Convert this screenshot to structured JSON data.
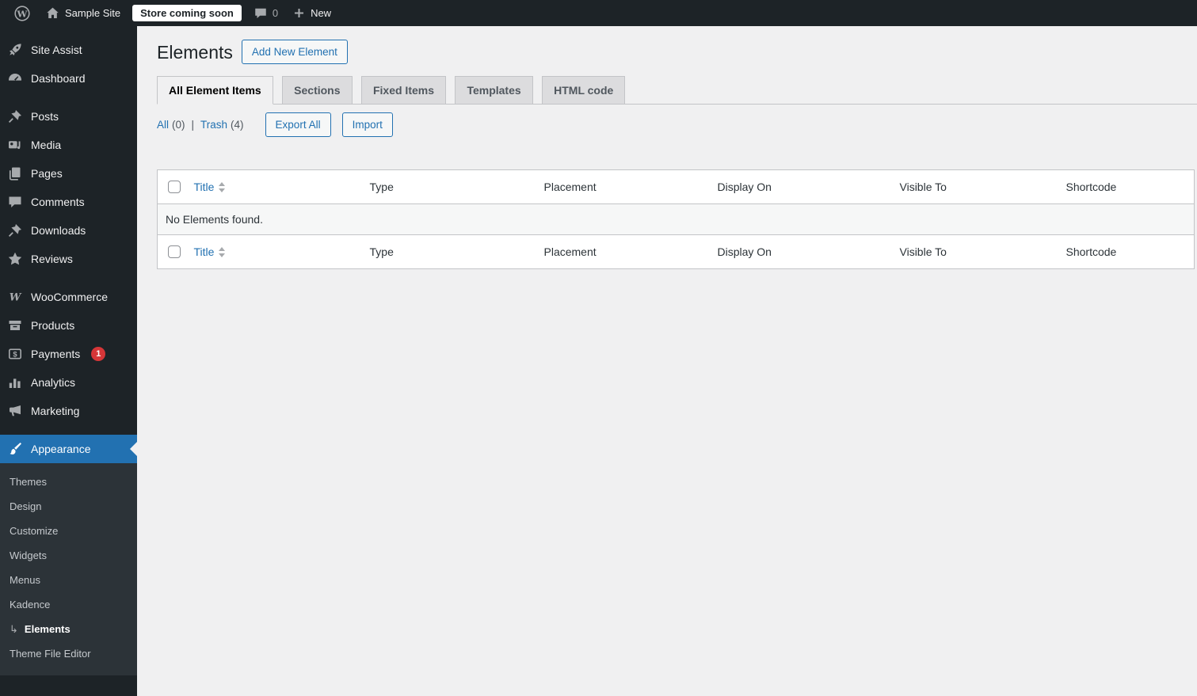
{
  "admin_bar": {
    "site_name": "Sample Site",
    "store_badge": "Store coming soon",
    "comment_count": "0",
    "new_label": "New"
  },
  "sidebar": {
    "items": [
      {
        "label": "Site Assist"
      },
      {
        "label": "Dashboard"
      },
      {
        "label": "Posts"
      },
      {
        "label": "Media"
      },
      {
        "label": "Pages"
      },
      {
        "label": "Comments"
      },
      {
        "label": "Downloads"
      },
      {
        "label": "Reviews"
      },
      {
        "label": "WooCommerce"
      },
      {
        "label": "Products"
      },
      {
        "label": "Payments"
      },
      {
        "label": "Analytics"
      },
      {
        "label": "Marketing"
      },
      {
        "label": "Appearance"
      }
    ],
    "payments_badge": "1",
    "submenu_arrow": "↳",
    "submenu": [
      {
        "label": "Themes"
      },
      {
        "label": "Design"
      },
      {
        "label": "Customize"
      },
      {
        "label": "Widgets"
      },
      {
        "label": "Menus"
      },
      {
        "label": "Kadence"
      },
      {
        "label": "Elements"
      },
      {
        "label": "Theme File Editor"
      }
    ]
  },
  "main": {
    "page_title": "Elements",
    "add_new_label": "Add New Element",
    "tabs": [
      {
        "label": "All Element Items"
      },
      {
        "label": "Sections"
      },
      {
        "label": "Fixed Items"
      },
      {
        "label": "Templates"
      },
      {
        "label": "HTML code"
      }
    ],
    "filters": {
      "all_label": "All",
      "all_count": "(0)",
      "separator": "|",
      "trash_label": "Trash",
      "trash_count": "(4)"
    },
    "export_label": "Export All",
    "import_label": "Import",
    "table": {
      "columns": [
        {
          "label": "Title"
        },
        {
          "label": "Type"
        },
        {
          "label": "Placement"
        },
        {
          "label": "Display On"
        },
        {
          "label": "Visible To"
        },
        {
          "label": "Shortcode"
        }
      ],
      "empty_message": "No Elements found."
    }
  },
  "colors": {
    "accent_blue": "#2271b1",
    "admin_bar_bg": "#1d2327",
    "submenu_bg": "#2c3338",
    "page_bg": "#f0f0f1",
    "badge_red": "#d63638",
    "tab_inactive_bg": "#dcdcde",
    "border_gray": "#c3c4c7"
  }
}
